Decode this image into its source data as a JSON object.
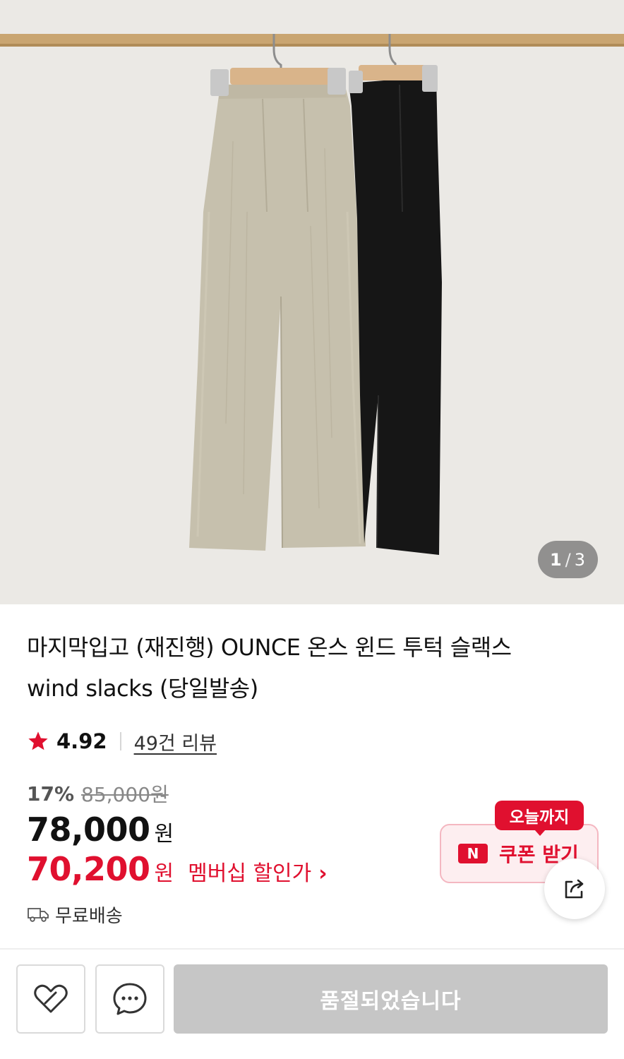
{
  "gallery": {
    "current": "1",
    "separator": "/",
    "total": "3"
  },
  "product": {
    "title_line1": "마지막입고 (재진행) OUNCE 온스 윈드 투턱 슬랙스",
    "title_line2": "wind slacks (당일발송)"
  },
  "rating": {
    "icon": "star-icon",
    "score": "4.92",
    "reviews_label": "49건 리뷰"
  },
  "price": {
    "discount_pct": "17%",
    "original": "85,000원",
    "sale_amount": "78,000",
    "sale_unit": "원",
    "member_amount": "70,200",
    "member_unit": "원",
    "member_label": "멤버십 할인가",
    "member_chevron": "›"
  },
  "shipping": {
    "icon": "truck-icon",
    "label": "무료배송"
  },
  "coupon": {
    "tag": "오늘까지",
    "logo": "N",
    "label": "쿠폰 받기"
  },
  "bottom_bar": {
    "wishlist_icon": "heart-icon",
    "chat_icon": "chat-bubble-icon",
    "soldout_label": "품절되었습니다"
  },
  "colors": {
    "accent_red": "#e0102f",
    "soldout_gray": "#c6c6c6"
  }
}
